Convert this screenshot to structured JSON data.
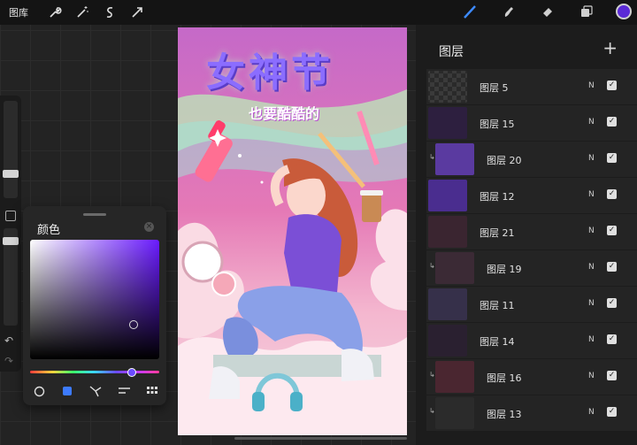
{
  "topbar": {
    "gallery_label": "图库",
    "tools_left": [
      "wrench-icon",
      "magic-wand-icon",
      "selection-s-icon",
      "transform-arrow-icon"
    ],
    "tools_right": [
      "brush-icon",
      "smudge-icon",
      "eraser-icon",
      "layers-icon"
    ],
    "current_color": "#5b2ad6"
  },
  "color_panel": {
    "title": "颜色",
    "hue_color": "#6a1bff",
    "modes": [
      "disc-mode",
      "classic-mode",
      "harmony-mode",
      "value-mode",
      "palette-mode"
    ]
  },
  "canvas": {
    "title": "女神节",
    "subtitle": "也要酷酷的"
  },
  "layers": {
    "title": "图层",
    "add_label": "+",
    "items": [
      {
        "name": "图层 5",
        "blend": "N",
        "clipped": false,
        "thumb": "#3a3a3a"
      },
      {
        "name": "图层 15",
        "blend": "N",
        "clipped": false,
        "thumb": "#2d1f3f"
      },
      {
        "name": "图层 20",
        "blend": "N",
        "clipped": true,
        "thumb": "#5a3aa0"
      },
      {
        "name": "图层 12",
        "blend": "N",
        "clipped": false,
        "thumb": "#4a2d8f"
      },
      {
        "name": "图层 21",
        "blend": "N",
        "clipped": false,
        "thumb": "#3a2530"
      },
      {
        "name": "图层 19",
        "blend": "N",
        "clipped": true,
        "thumb": "#3b2a35"
      },
      {
        "name": "图层 11",
        "blend": "N",
        "clipped": false,
        "thumb": "#36304a"
      },
      {
        "name": "图层 14",
        "blend": "N",
        "clipped": false,
        "thumb": "#2a2030"
      },
      {
        "name": "图层 16",
        "blend": "N",
        "clipped": true,
        "thumb": "#4a2630"
      },
      {
        "name": "图层 13",
        "blend": "N",
        "clipped": true,
        "thumb": "#2b2b2b"
      }
    ]
  }
}
